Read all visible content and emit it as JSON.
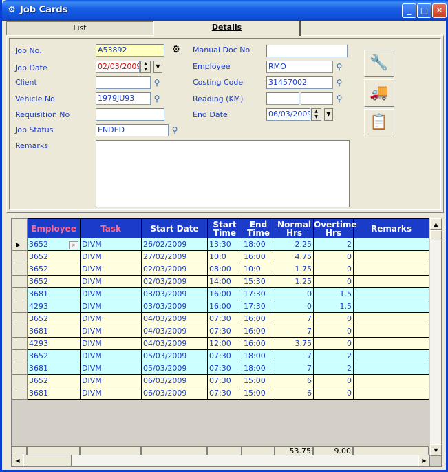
{
  "window": {
    "title": "Job Cards"
  },
  "tabs": [
    {
      "label": "List"
    },
    {
      "label": "Details"
    }
  ],
  "form": {
    "job_no": {
      "label": "Job No.",
      "value": "A53892"
    },
    "job_date": {
      "label": "Job Date",
      "value": "02/03/2009"
    },
    "client": {
      "label": "Client",
      "value": ""
    },
    "vehicle_no": {
      "label": "Vehicle No",
      "value": "1979JU93"
    },
    "requisition_no": {
      "label": "Requisition No",
      "value": ""
    },
    "job_status": {
      "label": "Job Status",
      "value": "ENDED"
    },
    "remarks": {
      "label": "Remarks",
      "value": ""
    },
    "manual_doc_no": {
      "label": "Manual Doc No",
      "value": ""
    },
    "employee": {
      "label": "Employee",
      "value": "RMO"
    },
    "costing_code": {
      "label": "Costing Code",
      "value": "31457002"
    },
    "reading": {
      "label": "Reading (KM)",
      "value1": "",
      "value2": ""
    },
    "end_date": {
      "label": "End Date",
      "value": "06/03/2009"
    }
  },
  "grid": {
    "headers": {
      "employee": "Employee",
      "task": "Task",
      "start_date": "Start Date",
      "start_time_1": "Start",
      "start_time_2": "Time",
      "end_time_1": "End",
      "end_time_2": "Time",
      "normal_1": "Normal",
      "normal_2": "Hrs",
      "overtime_1": "Overtime",
      "overtime_2": "Hrs",
      "remarks": "Remarks"
    },
    "rows": [
      {
        "employee": "3652",
        "task": "DIVM",
        "start_date": "26/02/2009",
        "start_time": "13:30",
        "end_time": "18:00",
        "normal": "2.25",
        "overtime": "2",
        "remarks": ""
      },
      {
        "employee": "3652",
        "task": "DIVM",
        "start_date": "27/02/2009",
        "start_time": "10:0",
        "end_time": "16:00",
        "normal": "4.75",
        "overtime": "0",
        "remarks": ""
      },
      {
        "employee": "3652",
        "task": "DIVM",
        "start_date": "02/03/2009",
        "start_time": "08:00",
        "end_time": "10:0",
        "normal": "1.75",
        "overtime": "0",
        "remarks": ""
      },
      {
        "employee": "3652",
        "task": "DIVM",
        "start_date": "02/03/2009",
        "start_time": "14:00",
        "end_time": "15:30",
        "normal": "1.25",
        "overtime": "0",
        "remarks": ""
      },
      {
        "employee": "3681",
        "task": "DIVM",
        "start_date": "03/03/2009",
        "start_time": "16:00",
        "end_time": "17:30",
        "normal": "0",
        "overtime": "1.5",
        "remarks": ""
      },
      {
        "employee": "4293",
        "task": "DIVM",
        "start_date": "03/03/2009",
        "start_time": "16:00",
        "end_time": "17:30",
        "normal": "0",
        "overtime": "1.5",
        "remarks": ""
      },
      {
        "employee": "3652",
        "task": "DIVM",
        "start_date": "04/03/2009",
        "start_time": "07:30",
        "end_time": "16:00",
        "normal": "7",
        "overtime": "0",
        "remarks": ""
      },
      {
        "employee": "3681",
        "task": "DIVM",
        "start_date": "04/03/2009",
        "start_time": "07:30",
        "end_time": "16:00",
        "normal": "7",
        "overtime": "0",
        "remarks": ""
      },
      {
        "employee": "4293",
        "task": "DIVM",
        "start_date": "04/03/2009",
        "start_time": "12:00",
        "end_time": "16:00",
        "normal": "3.75",
        "overtime": "0",
        "remarks": ""
      },
      {
        "employee": "3652",
        "task": "DIVM",
        "start_date": "05/03/2009",
        "start_time": "07:30",
        "end_time": "18:00",
        "normal": "7",
        "overtime": "2",
        "remarks": ""
      },
      {
        "employee": "3681",
        "task": "DIVM",
        "start_date": "05/03/2009",
        "start_time": "07:30",
        "end_time": "18:00",
        "normal": "7",
        "overtime": "2",
        "remarks": ""
      },
      {
        "employee": "3652",
        "task": "DIVM",
        "start_date": "06/03/2009",
        "start_time": "07:30",
        "end_time": "15:00",
        "normal": "6",
        "overtime": "0",
        "remarks": ""
      },
      {
        "employee": "3681",
        "task": "DIVM",
        "start_date": "06/03/2009",
        "start_time": "07:30",
        "end_time": "15:00",
        "normal": "6",
        "overtime": "0",
        "remarks": ""
      }
    ],
    "totals": {
      "normal": "53.75",
      "overtime": "9.00"
    }
  },
  "icons": {
    "app": "job-card-icon",
    "search": "magnifier-icon",
    "vehicle": "truck-icon",
    "tools": "wrench-icon",
    "report": "report-icon"
  }
}
